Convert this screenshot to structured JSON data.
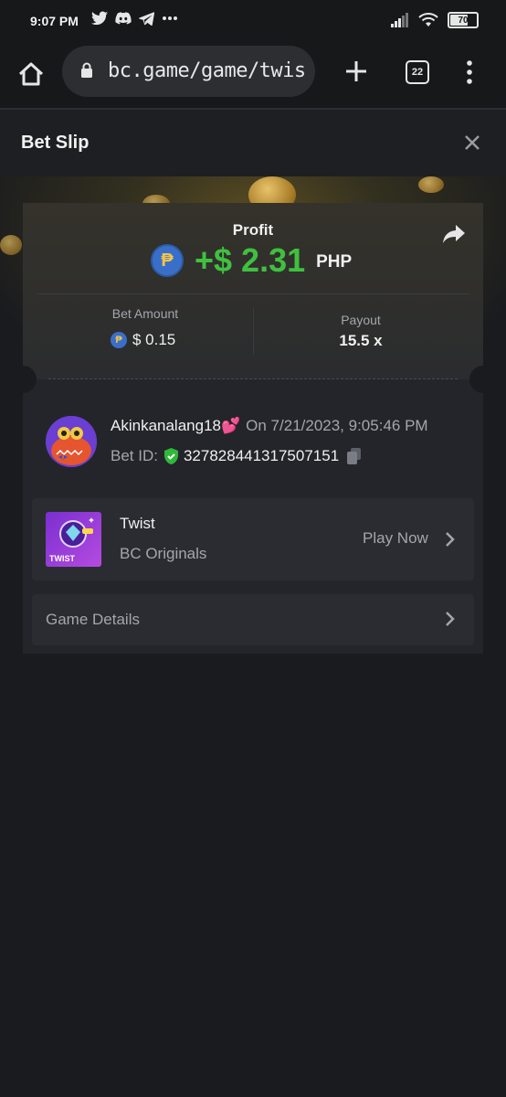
{
  "status_bar": {
    "time": "9:07 PM",
    "battery": "70",
    "left_icons": [
      "twitter-icon",
      "discord-icon",
      "telegram-icon",
      "more-dots-icon"
    ],
    "right_icons": [
      "signal-icon",
      "wifi-icon",
      "battery-icon"
    ]
  },
  "browser": {
    "url": "bc.game/game/twis",
    "tab_count": "22"
  },
  "header": {
    "title": "Bet Slip"
  },
  "slip": {
    "profit_label": "Profit",
    "profit_value": "+$ 2.31",
    "profit_currency": "PHP",
    "currency_symbol": "₱",
    "bet_amount_label": "Bet Amount",
    "bet_amount_value": "$ 0.15",
    "payout_label": "Payout",
    "payout_value": "15.5 x"
  },
  "player": {
    "username": "Akinkanalang18💕",
    "date": "On 7/21/2023, 9:05:46 PM",
    "bet_id_label": "Bet ID:",
    "bet_id": "327828441317507151"
  },
  "game": {
    "name": "Twist",
    "provider": "BC Originals",
    "play_label": "Play Now",
    "thumb_label": "TWIST"
  },
  "details": {
    "label": "Game Details"
  },
  "colors": {
    "profit_green": "#3fc13f",
    "background": "#1a1b1e",
    "card": "#24252a"
  }
}
